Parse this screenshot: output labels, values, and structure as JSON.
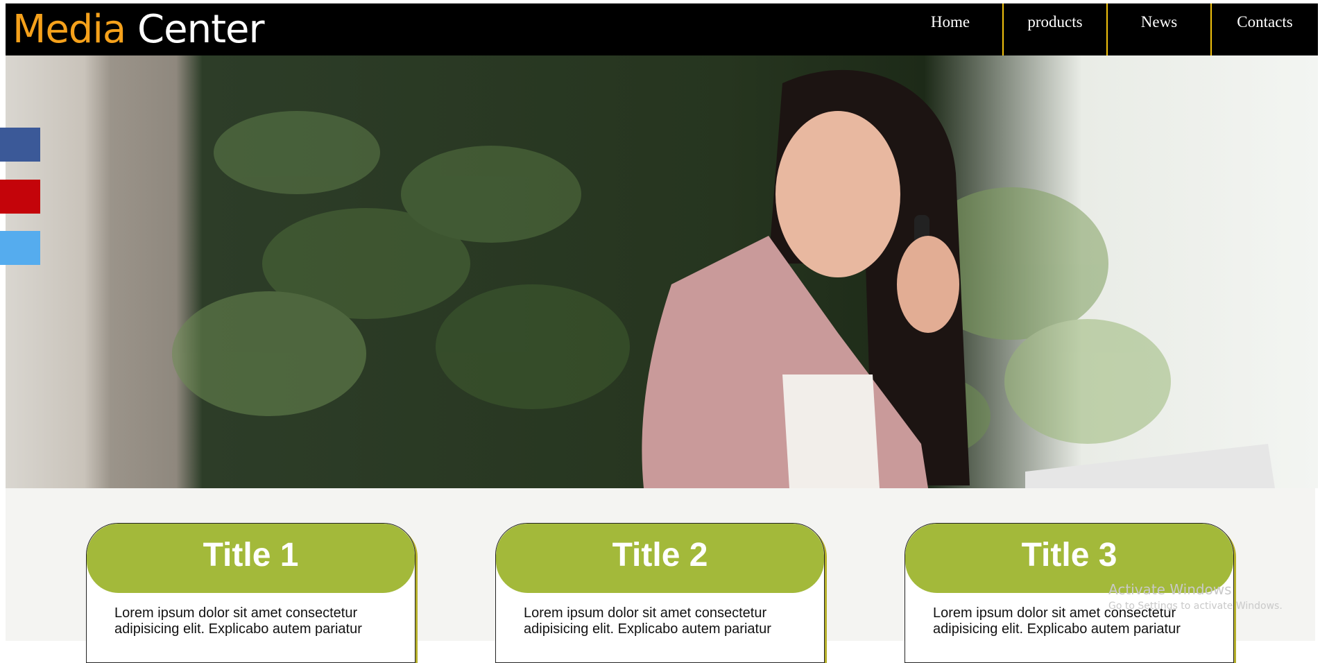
{
  "header": {
    "logo_part1": "Media",
    "logo_part2": "Center",
    "nav": [
      "Home",
      "products",
      "News",
      "Contacts"
    ]
  },
  "colors": {
    "logo_accent": "#f5a11b",
    "nav_divider": "#f2c20d",
    "card_title_bg": "#a3b93a",
    "facebook": "#3b5998",
    "youtube": "#c4040a",
    "twitter": "#55acee"
  },
  "social": [
    "facebook-icon",
    "youtube-icon",
    "twitter-icon"
  ],
  "cards": [
    {
      "title": "Title 1",
      "text": "Lorem ipsum dolor sit amet consectetur adipisicing elit. Explicabo autem pariatur"
    },
    {
      "title": "Title 2",
      "text": "Lorem ipsum dolor sit amet consectetur adipisicing elit. Explicabo autem pariatur"
    },
    {
      "title": "Title 3",
      "text": "Lorem ipsum dolor sit amet consectetur adipisicing elit. Explicabo autem pariatur"
    }
  ],
  "watermark": {
    "line1": "Activate Windows",
    "line2": "Go to Settings to activate Windows."
  }
}
